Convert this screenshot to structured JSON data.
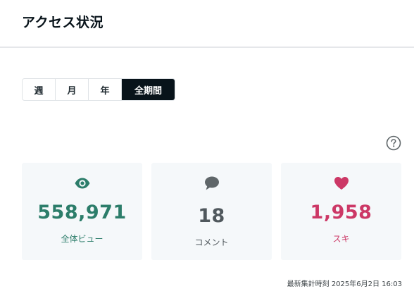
{
  "header": {
    "title": "アクセス状況"
  },
  "period_tabs": [
    {
      "label": "週"
    },
    {
      "label": "月"
    },
    {
      "label": "年"
    },
    {
      "label": "全期間",
      "selected": true
    }
  ],
  "help": {
    "icon": "question-circle-icon"
  },
  "stats": {
    "views": {
      "icon": "eye-icon",
      "value": "558,971",
      "label": "全体ビュー",
      "color": "#2c7d6a"
    },
    "comments": {
      "icon": "speech-bubble-icon",
      "value": "18",
      "label": "コメント",
      "color": "#50585d"
    },
    "likes": {
      "icon": "heart-icon",
      "value": "1,958",
      "label": "スキ",
      "color": "#cc3866"
    }
  },
  "footer": {
    "last_updated": "最新集計時刻 2025年6月2日 16:03"
  }
}
